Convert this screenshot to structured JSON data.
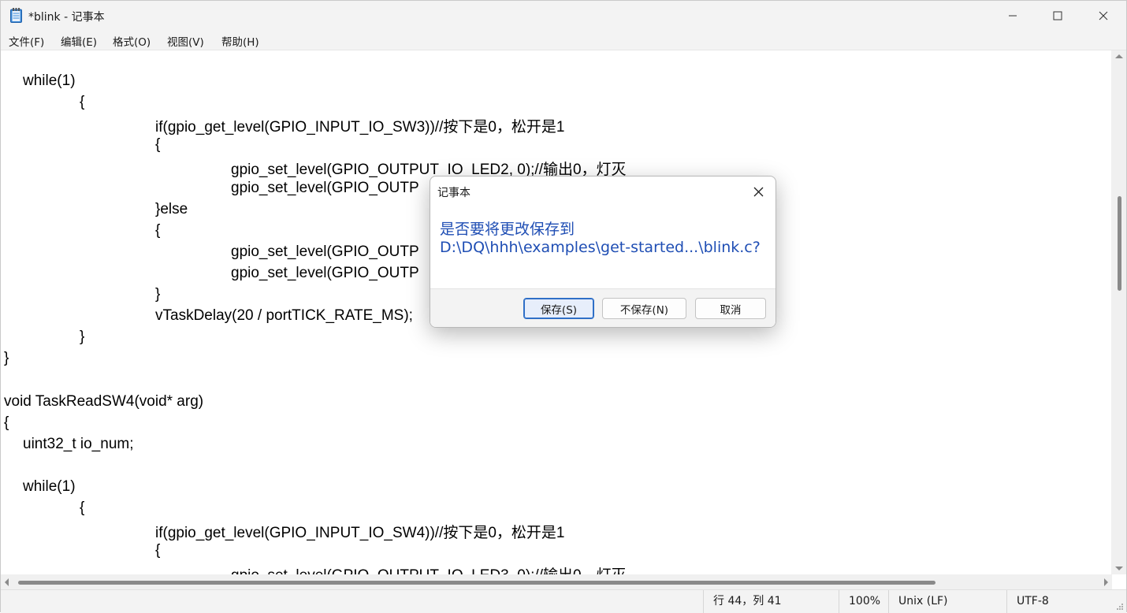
{
  "window": {
    "title": "*blink - 记事本"
  },
  "menu": [
    "文件(F)",
    "编辑(E)",
    "格式(O)",
    "视图(V)",
    "帮助(H)"
  ],
  "editor": {
    "lines": [
      {
        "text": "while(1)",
        "indent": 1
      },
      {
        "text": "{",
        "indent": 2
      },
      {
        "text": "if(gpio_get_level(GPIO_INPUT_IO_SW3))//按下是0，松开是1",
        "indent": 3
      },
      {
        "text": "{",
        "indent": 3
      },
      {
        "text": "gpio_set_level(GPIO_OUTPUT_IO_LED2, 0);//输出0，灯灭",
        "indent": 4
      },
      {
        "text": "gpio_set_level(GPIO_OUTP",
        "indent": 4
      },
      {
        "text": "}else",
        "indent": 3
      },
      {
        "text": "{",
        "indent": 3
      },
      {
        "text": "gpio_set_level(GPIO_OUTP",
        "indent": 4
      },
      {
        "text": "gpio_set_level(GPIO_OUTP",
        "indent": 4
      },
      {
        "text": "}",
        "indent": 3
      },
      {
        "text": "vTaskDelay(20 / portTICK_RATE_MS);",
        "indent": 3
      },
      {
        "text": "}",
        "indent": 2
      },
      {
        "text": "}",
        "indent": 0
      },
      {
        "text": "",
        "indent": 0
      },
      {
        "text": "void TaskReadSW4(void* arg)",
        "indent": 0
      },
      {
        "text": "{",
        "indent": 0
      },
      {
        "text": "uint32_t io_num;",
        "indent": 1
      },
      {
        "text": "",
        "indent": 0
      },
      {
        "text": "while(1)",
        "indent": 1
      },
      {
        "text": "{",
        "indent": 2
      },
      {
        "text": "if(gpio_get_level(GPIO_INPUT_IO_SW4))//按下是0，松开是1",
        "indent": 3
      },
      {
        "text": "{",
        "indent": 3
      },
      {
        "text": "gpio_set_level(GPIO_OUTPUT_IO_LED3, 0);//输出0，灯灭",
        "indent": 4
      }
    ]
  },
  "status": {
    "position": "行 44，列 41",
    "zoom": "100%",
    "line_ending": "Unix (LF)",
    "encoding": "UTF-8"
  },
  "dialog": {
    "title": "记事本",
    "message_line1": "是否要将更改保存到",
    "message_line2": "D:\\DQ\\hhh\\examples\\get-started...\\blink.c?",
    "save_label": "保存(S)",
    "dont_save_label": "不保存(N)",
    "cancel_label": "取消"
  },
  "colors": {
    "accent": "#2f6fc7",
    "message_text": "#1f4eb4"
  }
}
